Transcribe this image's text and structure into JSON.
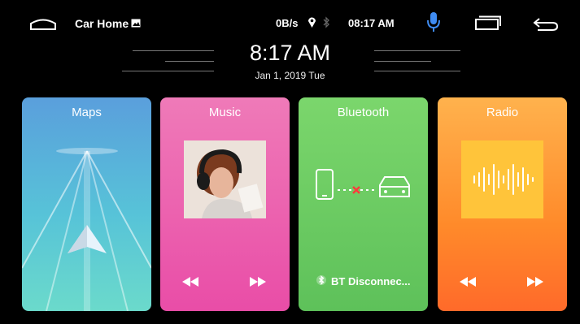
{
  "statusbar": {
    "app_title": "Car Home",
    "net_speed": "0B/s",
    "time": "08:17 AM"
  },
  "clock": {
    "time": "8:17 AM",
    "date": "Jan 1, 2019 Tue"
  },
  "cards": {
    "maps": {
      "title": "Maps"
    },
    "music": {
      "title": "Music"
    },
    "bluetooth": {
      "title": "Bluetooth",
      "status": "BT Disconnec..."
    },
    "radio": {
      "title": "Radio"
    }
  },
  "colors": {
    "maps": "#5ab0dc",
    "music": "#eb5fb0",
    "bluetooth": "#6ccb60",
    "radio": "#ff9a38"
  },
  "icons": {
    "home": "home-icon",
    "gallery": "image-icon",
    "location": "location-pin-icon",
    "bluetooth": "bluetooth-icon",
    "mic": "microphone-icon",
    "recents": "recent-apps-icon",
    "back": "back-arrow-icon"
  }
}
